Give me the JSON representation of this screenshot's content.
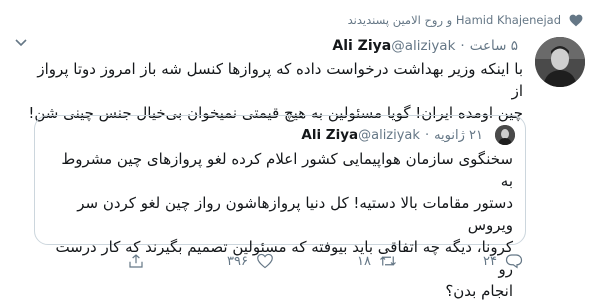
{
  "social_context": {
    "text": "Hamid Khajenejad و روح الامین پسندیدند",
    "icon": "heart-icon"
  },
  "tweet": {
    "author_name": "Ali Ziya",
    "handle": "@aliziyak",
    "separator": "·",
    "time": "۵ ساعت",
    "lines": [
      "با اینکه وزیر بهداشت درخواست داده که پروازها کنسل شه باز امروز دوتا پرواز از",
      "چین اومده ایران! گویا مسئولین به هیچ قیمتی نمیخوان بی‌خیال جنس چینی شن!"
    ]
  },
  "quoted_tweet": {
    "author_name": "Ali Ziya",
    "handle": "@aliziyak",
    "separator": "·",
    "date": "۲۱ ژانویه",
    "lines": [
      "سخنگوی سازمان هواپیمایی کشور اعلام کرده لغو پروازهای چین مشروط به",
      "دستور مقامات بالا دستیه! کل دنیا پروازهاشون رواز چین لغو کردن سر ویروس",
      "کرونا، دیگه چه اتفاقی باید بیوفته که مسئولین تصمیم بگیرند که کار درست رو",
      "انجام بدن؟"
    ]
  },
  "actions": {
    "reply_count": "۲۴",
    "retweet_count": "۱۸",
    "like_count": "۳۹۶"
  },
  "colors": {
    "text": "#14171a",
    "secondary": "#657786",
    "border": "#ccd6dd"
  }
}
